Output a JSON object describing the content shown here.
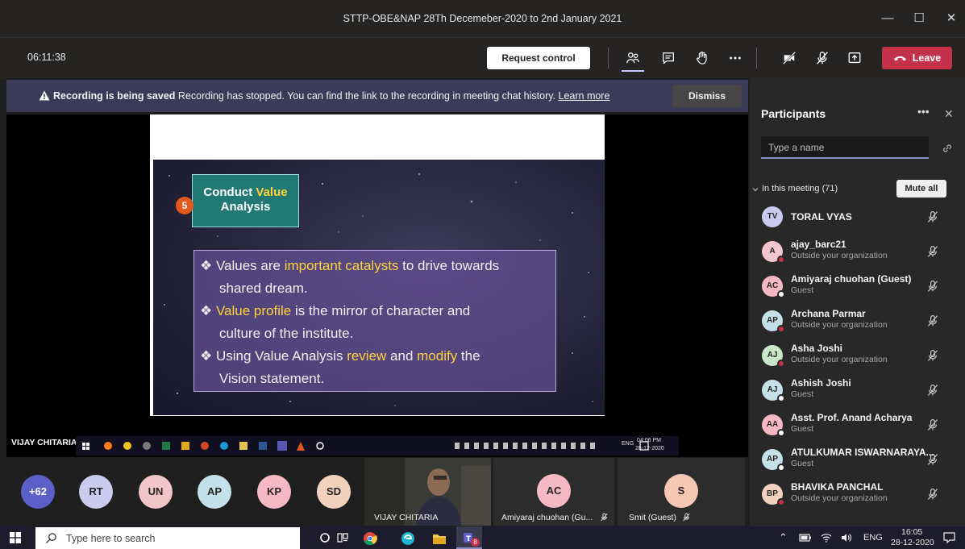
{
  "window": {
    "title": "STTP-OBE&NAP 28Th Decemeber-2020 to 2nd January 2021"
  },
  "toolbar": {
    "timer": "06:11:38",
    "request_control": "Request control",
    "leave": "Leave"
  },
  "banner": {
    "bold": "Recording is being saved",
    "text": " Recording has stopped. You can find the link to the recording in meeting chat history. ",
    "link": "Learn more",
    "dismiss": "Dismiss"
  },
  "slide": {
    "number": "5",
    "heading_line1_a": "Conduct ",
    "heading_line1_b": "Value",
    "heading_line2": "Analysis",
    "b1_a": "Values are ",
    "b1_hl": "important catalysts",
    "b1_b": " to drive towards",
    "b1_c": "shared dream.",
    "b2_hl": "Value profile",
    "b2_a": " is the mirror of character and",
    "b2_b": "culture of the institute.",
    "b3_a": "Using Value Analysis ",
    "b3_hl1": "review",
    "b3_mid": " and ",
    "b3_hl2": "modify",
    "b3_b": " the",
    "b3_c": "Vision statement."
  },
  "shared_screen": {
    "presenter": "VIJAY CHITARIA",
    "clock_time": "04:06 PM",
    "clock_date": "28-12-2020",
    "lang": "ENG"
  },
  "strip": {
    "more_count": "+62",
    "avatars": [
      {
        "initials": "RT",
        "color": "#cbcbf0"
      },
      {
        "initials": "UN",
        "color": "#f2c6c6"
      },
      {
        "initials": "AP",
        "color": "#c4e0e8"
      },
      {
        "initials": "KP",
        "color": "#f6b9c4"
      },
      {
        "initials": "SD",
        "color": "#f3d2bd"
      }
    ],
    "video_name": "VIJAY CHITARIA",
    "tile1": {
      "initials": "AC",
      "label": "Amiyaraj chuohan (Gu...",
      "color": "#f6b9c4"
    },
    "tile2": {
      "initials": "S",
      "label": "Smit (Guest)",
      "color": "#f6c8b4"
    }
  },
  "panel": {
    "title": "Participants",
    "search_placeholder": "Type a name",
    "in_meeting": "In this meeting (71)",
    "mute_all": "Mute all",
    "participants": [
      {
        "initials": "TV",
        "name": "TORAL VYAS",
        "sub": "",
        "color": "#cbcbf0",
        "dot": ""
      },
      {
        "initials": "A",
        "name": "ajay_barc21",
        "sub": "Outside your organization",
        "color": "#f3c5ce",
        "dot": "red"
      },
      {
        "initials": "AC",
        "name": "Amiyaraj chuohan (Guest)",
        "sub": "Guest",
        "color": "#f6b9c4",
        "dot": "grey"
      },
      {
        "initials": "AP",
        "name": "Archana Parmar",
        "sub": "Outside your organization",
        "color": "#c4e0e8",
        "dot": "red"
      },
      {
        "initials": "AJ",
        "name": "Asha Joshi",
        "sub": "Outside your organization",
        "color": "#c9e6c8",
        "dot": "red"
      },
      {
        "initials": "AJ",
        "name": "Ashish Joshi",
        "sub": "Guest",
        "color": "#c4e0e8",
        "dot": "grey"
      },
      {
        "initials": "AA",
        "name": "Asst. Prof. Anand Acharya",
        "sub": "Guest",
        "color": "#f6b9c4",
        "dot": "grey"
      },
      {
        "initials": "AP",
        "name": "ATULKUMAR ISWARNARAYA...",
        "sub": "Guest",
        "color": "#c4e0e8",
        "dot": "grey"
      },
      {
        "initials": "BP",
        "name": "BHAVIKA PANCHAL",
        "sub": "Outside your organization",
        "color": "#f3d2bd",
        "dot": "red"
      }
    ]
  },
  "taskbar": {
    "search_placeholder": "Type here to search",
    "lang": "ENG",
    "time": "16:05",
    "date": "28-12-2020",
    "teams_badge": "8"
  }
}
